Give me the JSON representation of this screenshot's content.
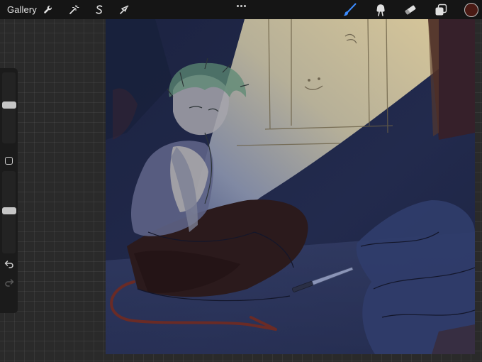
{
  "toolbar": {
    "gallery_label": "Gallery",
    "left_tools": [
      {
        "name": "actions",
        "icon": "wrench-icon"
      },
      {
        "name": "adjustments",
        "icon": "magic-wand-icon"
      },
      {
        "name": "selection",
        "icon": "selection-s-icon"
      },
      {
        "name": "transform",
        "icon": "arrow-cursor-icon"
      }
    ],
    "more_icon": "more-dots-icon",
    "right_tools": [
      {
        "name": "brush",
        "icon": "brush-icon",
        "active": true
      },
      {
        "name": "smudge",
        "icon": "smudge-icon",
        "active": false
      },
      {
        "name": "eraser",
        "icon": "eraser-icon",
        "active": false
      },
      {
        "name": "layers",
        "icon": "layers-icon",
        "active": false
      }
    ],
    "current_color": "#4a1a14"
  },
  "sidebar": {
    "brush_size_level": 0.54,
    "opacity_level": 0.52,
    "modifier_icon": "modifier-square-icon",
    "undo_icon": "undo-icon",
    "redo_icon": "redo-icon",
    "redo_enabled": false
  },
  "colors": {
    "accent": "#3c8cff",
    "toolbar_bg": "#151515",
    "background": "#2a2a2a",
    "canvas_night_blue": "#1e2540",
    "light_beam": "#d9c89b"
  }
}
